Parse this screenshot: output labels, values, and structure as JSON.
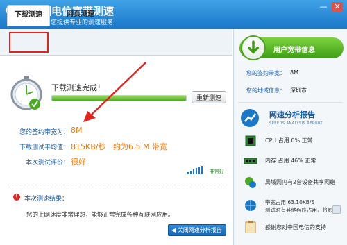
{
  "window": {
    "title": "中国电信宽带测速",
    "subtitle": "为您提供专业的测速服务",
    "minimize_glyph": "—",
    "close_glyph": "✕"
  },
  "tabs": [
    {
      "label": "下载测速",
      "active": true
    },
    {
      "label": "网页测速",
      "active": false
    }
  ],
  "test": {
    "status": "下载测速完成！",
    "progress_fraction": 1.0,
    "retest_label": "重新测速"
  },
  "results": {
    "rows": [
      {
        "label": "您的签约带宽为：",
        "value": "8M"
      },
      {
        "label": "下载测试平均值：",
        "value": "815KB/秒   约为6.5 M 带宽"
      },
      {
        "label": "本次测试评价：",
        "value": "很好"
      }
    ],
    "signal_text": "非常好"
  },
  "conclusion": {
    "icon": "warning-icon",
    "title": "本次测速结果：",
    "text": "您的上网速度非常理想，能够正常完成各种互联网应用。",
    "close_report_label": "◀ 关闭网速分析报告"
  },
  "broadband": {
    "title": "用户宽带信息",
    "contract_label": "您的签约带宽：",
    "contract_value": "8M",
    "location_label": "您的地域信息：",
    "location_value": "深圳市"
  },
  "report": {
    "title": "网速分析报告",
    "subtitle": "SPEEDS ANALYSIS REPORT",
    "items": [
      {
        "icon": "cpu-icon",
        "text": "CPU 占用  0% 正常"
      },
      {
        "icon": "memory-icon",
        "text": "内存 占用  46% 正常"
      },
      {
        "icon": "lan-share-icon",
        "text": "局域网内有2台设备共享网络"
      },
      {
        "icon": "bandwidth-globe-icon",
        "text": "带宽占用   63.10KB/S"
      },
      {
        "icon": "bandwidth-globe-icon",
        "text": "测试时有其他程序占用，将影响"
      },
      {
        "icon": "clipboard-icon",
        "text": "感谢您对中国电信的支持"
      }
    ]
  },
  "colors": {
    "title_bar": "#1a78c8",
    "accent_orange": "#f07a0c",
    "label_blue": "#1a5ea8",
    "green": "#4caa23",
    "annotation_red": "#e0231e"
  }
}
